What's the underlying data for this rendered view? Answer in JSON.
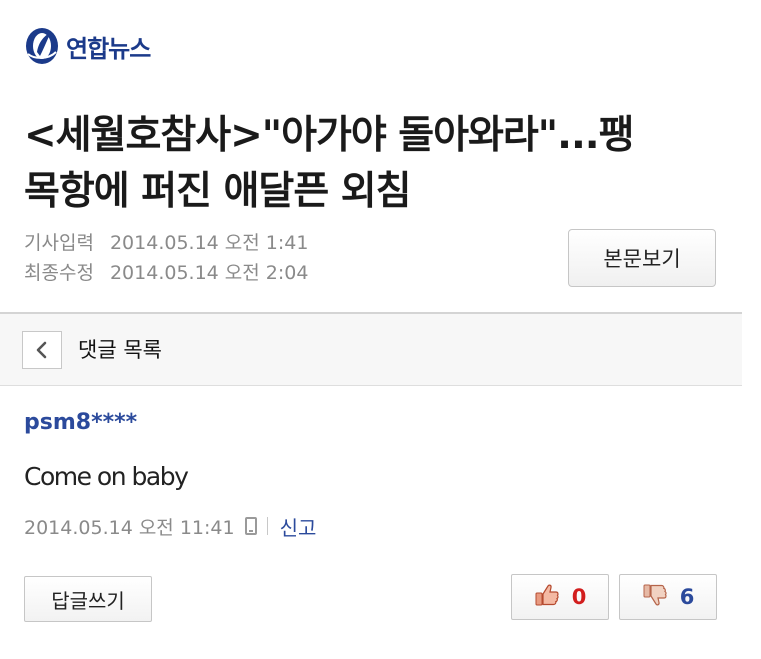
{
  "brand": {
    "name": "연합뉴스",
    "color": "#1b3a8a"
  },
  "article": {
    "headline_line1": "<세월호참사>\"아가야 돌아와라\"...팽",
    "headline_line2": "목항에 퍼진 애달픈 외침",
    "published_label": "기사입력",
    "published_value": "2014.05.14 오전 1:41",
    "modified_label": "최종수정",
    "modified_value": "2014.05.14 오전 2:04",
    "view_body_label": "본문보기"
  },
  "comments_bar": {
    "back_icon": "chevron-left-icon",
    "label": "댓글 목록"
  },
  "comment": {
    "author": "psm8****",
    "text": "Come on baby",
    "timestamp": "2014.05.14 오전 11:41",
    "device_icon": "mobile-phone-icon",
    "report_label": "신고",
    "reply_label": "답글쓰기",
    "likes": "0",
    "dislikes": "6",
    "like_icon": "thumbs-up-icon",
    "dislike_icon": "thumbs-down-icon"
  },
  "colors": {
    "link_blue": "#2b4a9c",
    "like_red": "#d21e1e",
    "meta_gray": "#8a8a8a"
  }
}
